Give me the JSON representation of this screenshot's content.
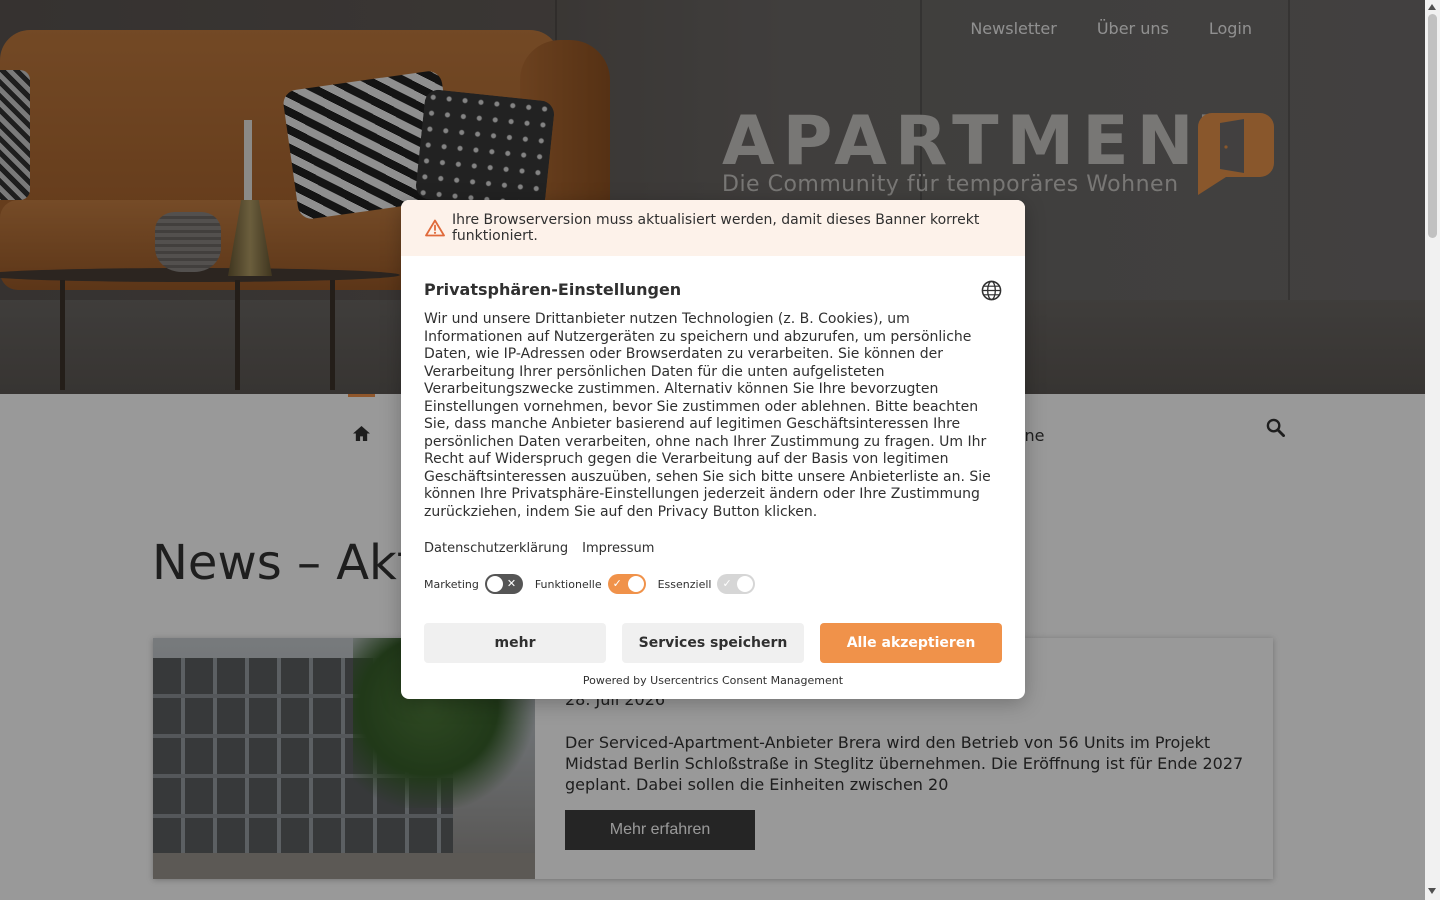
{
  "top_nav": {
    "items": [
      "Newsletter",
      "Über uns",
      "Login"
    ]
  },
  "logo": {
    "name": "APARTMENT",
    "tagline": "Die Community für temporäres Wohnen"
  },
  "main_nav": {
    "partial_item": "ine"
  },
  "content": {
    "page_title": "News – Akt",
    "news": {
      "date": "28. Juli 2026",
      "body": "Der Serviced-Apartment-Anbieter Brera wird den Betrieb von 56 Units im Projekt Midstad Berlin Schloßstraße in Steglitz übernehmen. Die Eröffnung ist für Ende 2027 geplant. Dabei sollen die Einheiten zwischen 20",
      "button": "Mehr erfahren"
    }
  },
  "consent": {
    "warning": "Ihre Browserversion muss aktualisiert werden, damit dieses Banner korrekt funktioniert.",
    "title": "Privatsphären-Einstellungen",
    "body": "Wir und unsere Drittanbieter nutzen Technologien (z. B. Cookies), um Informationen auf Nutzergeräten zu speichern und abzurufen, um persönliche Daten, wie IP-Adressen oder Browserdaten zu verarbeiten. Sie können der Verarbeitung Ihrer persönlichen Daten für die unten aufgelisteten Verarbeitungszwecke zustimmen. Alternativ können Sie Ihre bevorzugten Einstellungen vornehmen, bevor Sie zustimmen oder ablehnen. Bitte beachten Sie, dass manche Anbieter basierend auf legitimen Geschäftsinteressen Ihre persönlichen Daten verarbeiten, ohne nach Ihrer Zustimmung zu fragen. Um Ihr Recht auf Widerspruch gegen die Verarbeitung auf der Basis von legitimen Geschäftsinteressen auszuüben, sehen Sie sich bitte unsere Anbieterliste an. Sie können Ihre Privatsphäre-Einstellungen jederzeit ändern oder Ihre Zustimmung zurückziehen, indem Sie auf den Privacy Button klicken.",
    "links": [
      "Datenschutzerklärung",
      "Impressum"
    ],
    "toggles": [
      {
        "label": "Marketing",
        "state": "off"
      },
      {
        "label": "Funktionelle",
        "state": "on"
      },
      {
        "label": "Essenziell",
        "state": "disabled"
      }
    ],
    "buttons": {
      "more": "mehr",
      "save": "Services speichern",
      "accept_all": "Alle akzeptieren"
    },
    "powered_by": "Powered by Usercentrics Consent Management"
  },
  "colors": {
    "accent": "#f0924a",
    "overlay": "rgba(0,0,0,0.4)",
    "dark_button": "#3f3f3f"
  },
  "icons": [
    "home-icon",
    "search-icon",
    "warning-icon",
    "globe-icon",
    "check-icon",
    "cross-icon"
  ]
}
